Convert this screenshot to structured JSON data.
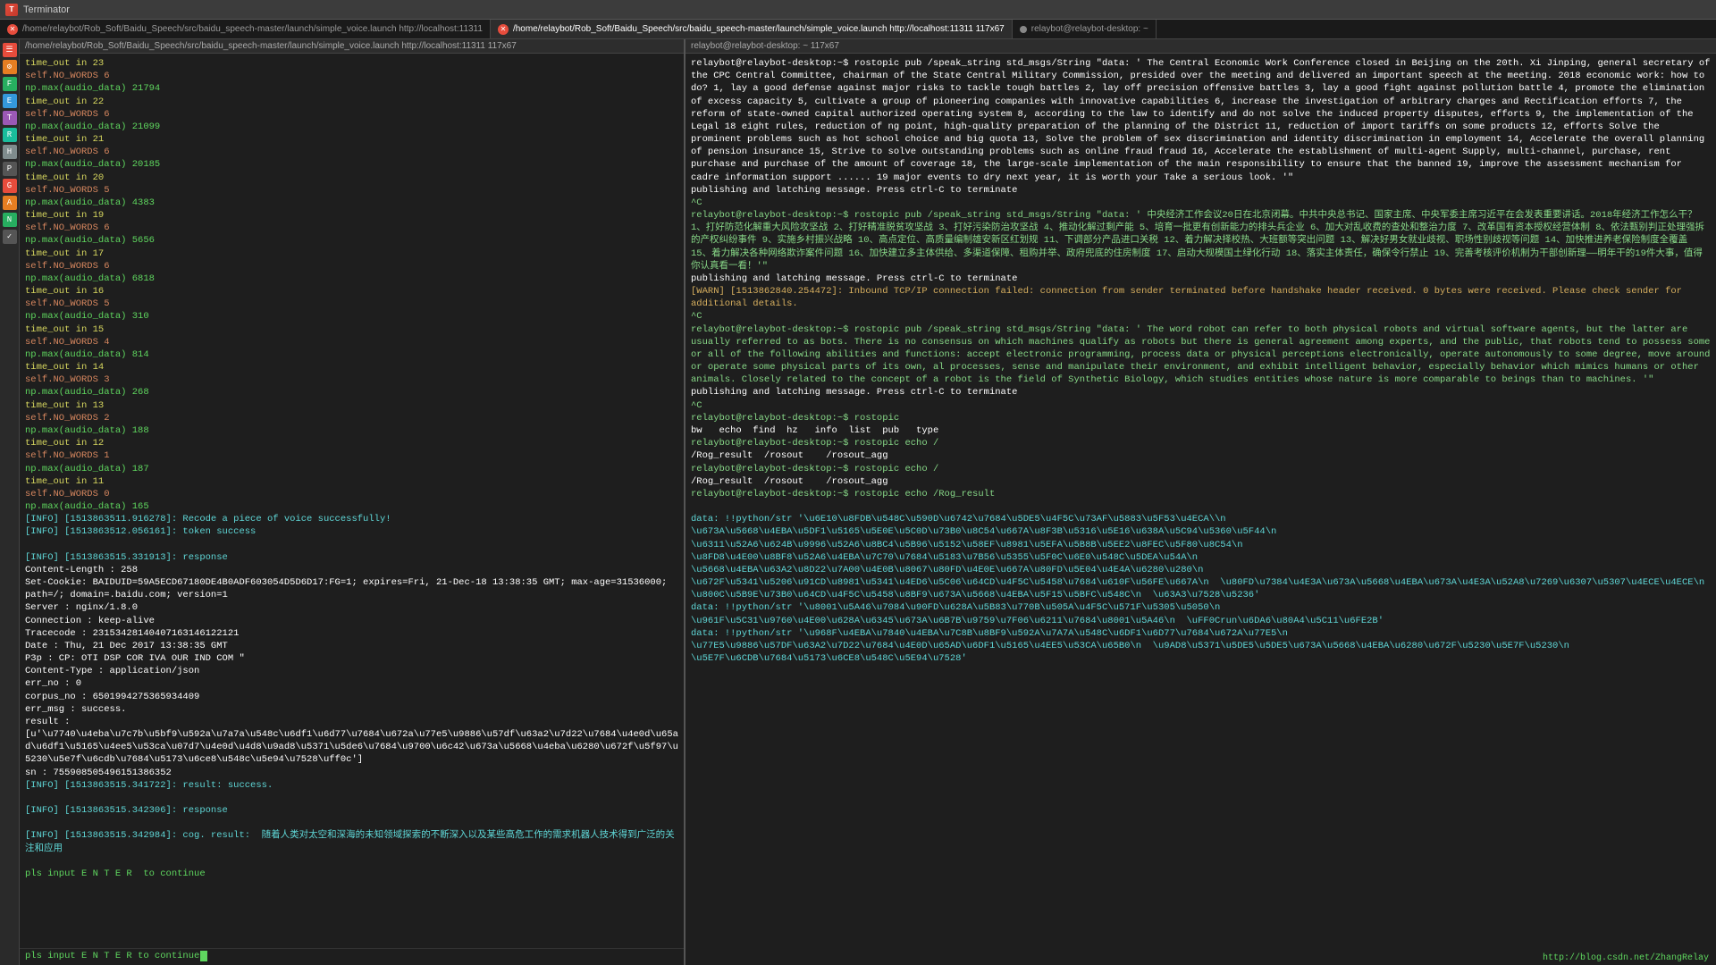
{
  "titlebar": {
    "title": "Terminator",
    "icon_label": "T"
  },
  "tabs": [
    {
      "id": "tab1",
      "active": false,
      "label": "/home/relaybot/Rob_Soft/Baidu_Speech/src/baidu_speech-master/launch/simple_voice.launch http://localhost:11311",
      "close_dot": "close"
    },
    {
      "id": "tab2",
      "active": true,
      "label": "/home/relaybot/Rob_Soft/Baidu_Speech/src/baidu_speech-master/launch/simple_voice.launch http://localhost:11311 117x67",
      "close_dot": "active"
    },
    {
      "id": "tab3",
      "active": false,
      "label": "relaybot@relaybot-desktop: ~",
      "close_dot": "dot"
    }
  ],
  "left_terminal": {
    "header": "/home/relaybot/Rob_Soft/Baidu_Speech/src/baidu_speech-master/launch/simple_voice.launch http://localhost:11311 117x67",
    "lines": [
      "time_out in 23",
      "self.NO_WORDS 6",
      "np.max(audio_data) 21794",
      "time_out in 22",
      "self.NO_WORDS 6",
      "np.max(audio_data) 21099",
      "time_out in 21",
      "self.NO_WORDS 6",
      "np.max(audio_data) 20185",
      "time_out in 20",
      "self.NO_WORDS 5",
      "np.max(audio_data) 4383",
      "time_out in 19",
      "self.NO_WORDS 6",
      "np.max(audio_data) 5656",
      "time_out in 17",
      "self.NO_WORDS 6",
      "np.max(audio_data) 6818",
      "time_out in 16",
      "self.NO_WORDS 5",
      "np.max(audio_data) 310",
      "time_out in 15",
      "self.NO_WORDS 4",
      "np.max(audio_data) 814",
      "time_out in 14",
      "self.NO_WORDS 3",
      "np.max(audio_data) 268",
      "time_out in 13",
      "self.NO_WORDS 2",
      "np.max(audio_data) 188",
      "time_out in 12",
      "self.NO_WORDS 1",
      "np.max(audio_data) 187",
      "time_out in 11",
      "self.NO_WORDS 0",
      "np.max(audio_data) 165",
      "[INFO] [1513863511.916278]: Recode a piece of voice successfully!",
      "[INFO] [1513863512.056161]: token success",
      "",
      "[INFO] [1513863515.331913]: response",
      "Content-Length : 258",
      "Set-Cookie: BAIDUID=59A5ECD67180DE4B0ADF603054D5D6D17:FG=1; expires=Fri, 21-Dec-18 13:38:35 GMT; max-age=31536000; path=/; domain=.baidu.com; version=1",
      "Server : nginx/1.8.0",
      "Connection : keep-alive",
      "Tracecode : 23153428140407163146122121",
      "Date : Thu, 21 Dec 2017 13:38:35 GMT",
      "P3p : CP: OTI DSP COR IVA OUR IND COM \"",
      "Content-Type : application/json",
      "err_no : 0",
      "corpus_no : 6501994275365934409",
      "err_msg : success.",
      "result : [u'\\u7740\\u4eba\\u7c7b\\u5bf9\\u592a\\u7a7a\\u548c\\u6df1\\u6d77\\u7684\\u672a\\u77e5\\u9886\\u57df\\u63a2\\u7d22\\u7684\\u4e0d\\u65ad\\u6df1\\u5165\\u4ee5\\u53ca\\u07d7\\u4e0d\\u4d8\\u9ad8\\u5371\\u5de6\\u7684\\u9700\\u6c42\\u673a\\u5668\\u4eba\\u6280\\u672f\\u5f97\\u5230\\u5e7f\\u6cdb\\u7684\\u5173\\u6ce8\\u548c\\u5e94\\u7528\\uff0c']",
      "sn : 755908505496151386352",
      "[INFO] [1513863515.341722]: result: success.",
      "",
      "[INFO] [1513863515.342306]: response",
      "",
      "[INFO] [1513863515.342984]: cog. result:  随着人类对太空和深海的未知领域探索的不断深入以及某些高危工作的需求机器人技术得到广泛的关注和应用",
      "",
      "pls input E N T E R  to continue"
    ],
    "input_line": "pls input E N T E R  to continue"
  },
  "right_terminal": {
    "header": "relaybot@relaybot-desktop: ~",
    "header2": "relaybot@relaybot-desktop: ~ 117x67",
    "content": [
      {
        "type": "normal",
        "text": "relaybot@relaybot-desktop:~$ rostopic pub /speak_string std_msgs/String \"data: ' The Central Economic Work Conference closed in Beijing on the 20th. Xi Jinping, general secretary of the CPC Central Committee, chairman of the State Central Military Commission, presided over the meeting and delivered an important speech at the meeting. 2018 economic work: how to do? 1, lay a good defense against major risks to tackle tough battles 2, lay off precision offensive battles 3, lay a good fight against pollution battle 4, promote the elimination of excess capacity 5, cultivate a group of pioneering companies with innovative capabilities 6, increase the investigation of arbitrary charges and Rectification efforts 7, the reform of state-owned capital authorized operating system 8, according to the law to identify and do not solve the induced property disputes, efforts 9, the implementation of the Legal 18 eight rules, reduction of ng point, high-quality preparation of the planning of the District 11, reduction of import tariffs on some products 12, efforts Solve the prominent problems such as hot school choice and big quota 13, Solve the problem of sex discrimination and identity discrimination in employment 14, Accelerate the overall planning of pension insurance 15, Strive to solve outstanding problems such as online fraud fraud 16, Accelerate the establishment of multi-agent Supply, multi-channel, purchase, rent purchase and purchase of the amount of coverage 18, the large-scale implementation of the main responsibility to ensure that the banned 19, improve the assessment mechanism for cadre information support ...... 19 major events to dry next year, it is worth your Take a serious look. '\""
      },
      {
        "type": "normal",
        "text": "publishing and latching message. Press ctrl-C to terminate"
      },
      {
        "type": "prompt",
        "text": "^C\nrelaybot@relaybot-desktop:~$ rostopic pub /speak_string std_msgs/String \"data: ' 中央经济工作会议20日在北京闭幕。中共中央总书记、国家主席、中央军委主席习近平在会发表重要讲话。2018年经济工作怎么干？1、打好防范化解重大风险攻坚战 2、打好精准脱贫攻坚战 3、打好污染防治攻坚战 4、推动化解过剩产能 5、培育一批更有创新能力的排头兵企业 6、加大对乱收费的查处和整治力度 7、改革国有资本授权经营体制 8、依法甄别判正处理强拆的产权纠纷事件 9、实施乡村振兴战略 10、高点定位、高质量编制雄安新区红划规 11、下调部分产品进口关税 12、着力解决择校热、大班额等突出问题 13、解决好男女就业歧视、职场性别歧视等问题 14、加快推进养老保险制度全覆盖 15、着力解决各种网络欺诈案件问题 16、加快建立多主体供给、多渠道保障、租购并举、政府兜底的住房制度 17、启动大规模国土绿化行动 18、落实主体责任，确保令行禁止 19、完善考核评价机制为干部创新理——明年干的19件大事，值得你认真看一看！'\""
      },
      {
        "type": "normal",
        "text": "publishing and latching message. Press ctrl-C to terminate"
      },
      {
        "type": "warn",
        "text": "[WARN] [1513862840.254472]: Inbound TCP/IP connection failed: connection from sender terminated before handshake header received. 0 bytes were received. Please check sender for additional details."
      },
      {
        "type": "prompt",
        "text": "^C\nrelaybot@relaybot-desktop:~$ rostopic pub /speak_string std_msgs/String \"data: ' The word robot can refer to both physical robots and virtual software agents, but the latter are usually referred to as bots. There is no consensus on which machines qualify as robots but there is general agreement among experts, and the public, that robots tend to possess some or all of the following abilities and functions: accept electronic programming, process data or physical perceptions electronically, operate autonomously to some degree, move around or operate some physical parts of its own, al processes, sense and manipulate their environment, and exhibit intelligent behavior, especially behavior which mimics humans or other animals. Closely related to the concept of a robot is the field of Synthetic Biology, which studies entities whose nature is more comparable to beings than to machines. '\""
      },
      {
        "type": "normal",
        "text": "publishing and latching message. Press ctrl-C to terminate"
      },
      {
        "type": "prompt",
        "text": "^C\nrelaybot@relaybot-desktop:~$ rostopic"
      },
      {
        "type": "normal",
        "text": "bw   echo  find  hz   info  list  pub   type"
      },
      {
        "type": "prompt",
        "text": "relaybot@relaybot-desktop:~$ rostopic echo /"
      },
      {
        "type": "normal",
        "text": "/Rog_result  /rosout    /rosout_agg"
      },
      {
        "type": "prompt",
        "text": "relaybot@relaybot-desktop:~$ rostopic echo /"
      },
      {
        "type": "normal",
        "text": "/Rog_result  /rosout    /rosout_agg"
      },
      {
        "type": "prompt",
        "text": "relaybot@relaybot-desktop:~$ rostopic echo /Rog_result"
      },
      {
        "type": "normal",
        "text": ""
      },
      {
        "type": "data",
        "text": "data: !!python/str '\\u6E10\\u8FDB\\u548C\\u590D\\u6742\\u7684\\u5DE5\\u4F5C\\u73AF\\u5883\\u5F53\\u4ECA\\\\n  \\u673A\\u5668\\u4EBA\\u5DF1\\u5165\\u5E0E\\u5C0D\\u73B0\\u8C54\\u667A\\u8F3B\\u5316\\u5E16\\u638A\\u5C94\\u5360\\u5F44\\n  \\u6311\\u52A6\\u624B\\u9996\\u52A6\\u8BC4\\u5B96\\u5152\\u58EF\\u8981\\u5EFA\\u5B8B\\u5EE2\\u8FEC\\u5F80\\u8C54\\n  \\u8FD8\\u4E00\\u8BF8\\u52A6\\u4EBA\\u7C70\\u7684\\u5183\\u7B56\\u5355\\u5F0C\\u6E0\\u548C\\u5DEA\\u54A\\n  \\u5668\\u4EBA\\u63A2\\u8D22\\u7A00\\u4E0B\\u8067\\u80FD\\u4E0E\\u667A\\u80FD\\u5E04\\u4E4A\\u6280\\u280\\n  \\u672F\\u5341\\u5206\\u91CD\\u8981\\u5341\\u4ED6\\u5C06\\u64CD\\u4F5C\\u5458\\u7684\\u610F\\u56FE\\u667A\\n  \\u80FD\\u7384\\u4E3A\\u673A\\u5668\\u4EBA\\u673A\\u4E3A\\u52A8\\u7269\\u6307\\u5307\\u4ECE\\u4ECE\\n  \\u800C\\u5B9E\\u73B0\\u64CD\\u4F5C\\u5458\\u8BF9\\u673A\\u5668\\u4EBA\\u5F15\\u5BFC\\u548C\\n  \\u63A3\\u7528\\u5236'"
      },
      {
        "type": "data",
        "text": "data: !!python/str '\\u8001\\u5A46\\u7084\\u90FD\\u628A\\u5B83\\u770B\\u505A\\u4F5C\\u571F\\u5305\\u5050\\n  \\u961F\\u5C31\\u9760\\u4E00\\u628A\\u6345\\u673A\\u6B7B\\u9759\\u7F06\\u6211\\u7684\\u8001\\u5A46\\n  \\uFF0Crun\\u6DA6\\u80A4\\u5C11\\u6FE2B'"
      },
      {
        "type": "data",
        "text": "data: !!python/str '\\u968F\\u4EBA\\u7840\\u4EBA\\u7C8B\\u8BF9\\u592A\\u7A7A\\u548C\\u6DF1\\u6D77\\u7684\\u672A\\u77E5\\n  \\u77E5\\u9886\\u57DF\\u63A2\\u7D22\\u7684\\u4E0D\\u65AD\\u6DF1\\u5165\\u4EE5\\u53CA\\u65B0\\n  \\u9AD8\\u5371\\u5DE5\\u5DE5\\u673A\\u5668\\u4EBA\\u6280\\u672F\\u5230\\u5E7F\\u5230\\n  \\u5E7F\\u6CDB\\u7684\\u5173\\u6CE8\\u548C\\u5E94\\u7528'"
      }
    ]
  },
  "status_bar": {
    "url": "http://blog.csdn.net/ZhangRelay"
  },
  "sidebar_icons": [
    "☰",
    "⚙",
    "F",
    "E",
    "T",
    "R",
    "H",
    "P",
    "G",
    "A",
    "N",
    "C"
  ]
}
